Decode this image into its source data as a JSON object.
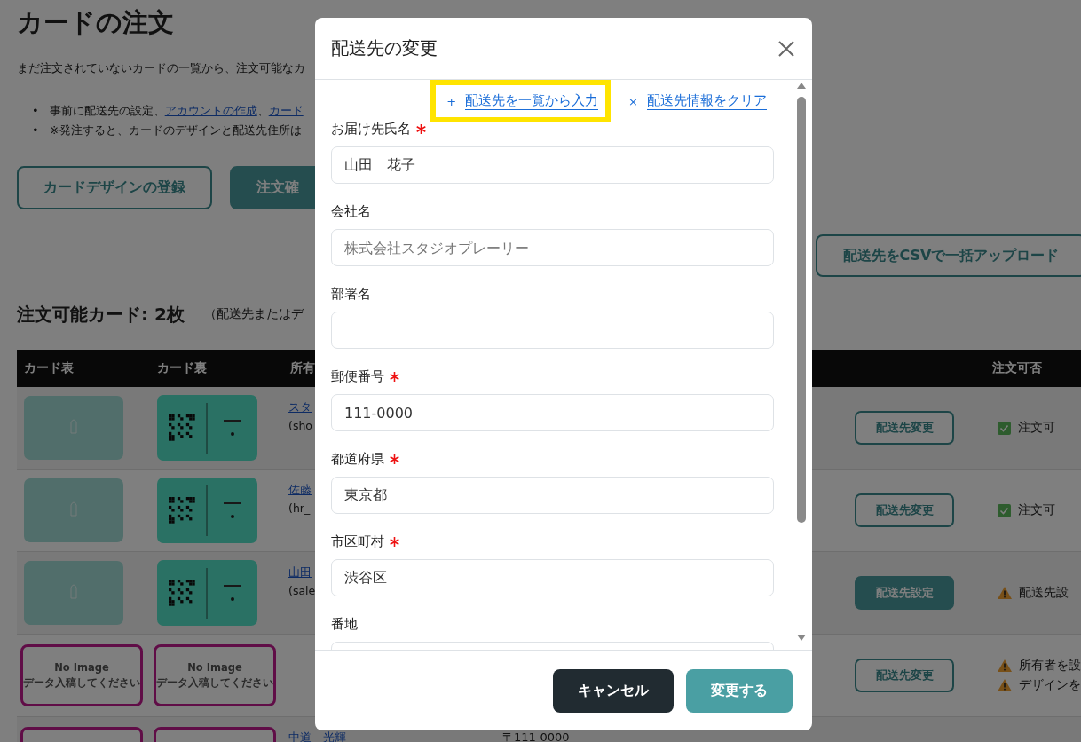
{
  "page": {
    "title": "カードの注文",
    "description": "まだ注文されていないカードの一覧から、注文可能なカ",
    "notes": [
      {
        "marker": "•",
        "parts": [
          {
            "kind": "text",
            "text": "事前に配送先の設定、"
          },
          {
            "kind": "link",
            "text": "アカウントの作成"
          },
          {
            "kind": "text",
            "text": "、"
          },
          {
            "kind": "link",
            "text": "カード"
          }
        ]
      },
      {
        "marker": "•",
        "parts": [
          {
            "kind": "text",
            "text": "※発注すると、カードのデザインと配送先住所は"
          }
        ]
      }
    ],
    "buttons": [
      {
        "label": "カードデザインの登録",
        "kind": "outline"
      },
      {
        "label": "注文確",
        "kind": "solid"
      }
    ],
    "csv_button": {
      "label": "配送先をCSVで一括アップロード"
    },
    "section": {
      "title": "注文可能カード: 2枚",
      "note": "（配送先またはデ"
    }
  },
  "table": {
    "columns": [
      "カード表",
      "カード裏",
      "所有"
    ],
    "status_column": "注文可否",
    "rows": [
      {
        "front": {
          "kind": "design"
        },
        "back": {
          "kind": "design"
        },
        "owner": {
          "name": "スタ",
          "id": "(sho"
        },
        "action": {
          "label": "配送先変更",
          "kind": "outline"
        },
        "status": [
          {
            "kind": "ok",
            "text": "注文可"
          }
        ]
      },
      {
        "front": {
          "kind": "design"
        },
        "back": {
          "kind": "design"
        },
        "owner": {
          "name": "佐藤",
          "id": "(hr_"
        },
        "action": {
          "label": "配送先変更",
          "kind": "outline"
        },
        "status": [
          {
            "kind": "ok",
            "text": "注文可"
          }
        ]
      },
      {
        "front": {
          "kind": "design"
        },
        "back": {
          "kind": "design"
        },
        "owner": {
          "name": "山田",
          "id": "(sale"
        },
        "action": {
          "label": "配送先設定",
          "kind": "solid"
        },
        "status": [
          {
            "kind": "warning",
            "text": "配送先設"
          }
        ]
      },
      {
        "front": {
          "kind": "no_image",
          "lines": [
            "No Image",
            "データ入稿してください"
          ]
        },
        "back": {
          "kind": "no_image",
          "lines": [
            "No Image",
            "データ入稿してください"
          ]
        },
        "action": {
          "label": "配送先変更",
          "kind": "outline"
        },
        "status": [
          {
            "kind": "warning",
            "text": "所有者を設"
          },
          {
            "kind": "warning",
            "text": "デザインを"
          }
        ]
      },
      {
        "front": {
          "kind": "no_image"
        },
        "back": {
          "kind": "no_image"
        },
        "owner": {
          "name": "中道　光輝"
        },
        "address": "〒111-0000"
      }
    ]
  },
  "modal": {
    "title": "配送先の変更",
    "links": [
      {
        "icon": "+",
        "label": "配送先を一覧から入力",
        "highlighted": true
      },
      {
        "icon": "×",
        "label": "配送先情報をクリア",
        "highlighted": false
      }
    ],
    "fields": [
      {
        "label": "お届け先氏名",
        "required": true,
        "value": "山田　花子"
      },
      {
        "label": "会社名",
        "required": false,
        "placeholder": "株式会社スタジオプレーリー"
      },
      {
        "label": "部署名",
        "required": false
      },
      {
        "label": "郵便番号",
        "required": true,
        "value": "111-0000"
      },
      {
        "label": "都道府県",
        "required": true,
        "value": "東京都"
      },
      {
        "label": "市区町村",
        "required": true,
        "value": "渋谷区"
      },
      {
        "label": "番地",
        "required": false
      }
    ],
    "buttons": [
      {
        "label": "キャンセル",
        "kind": "dark"
      },
      {
        "label": "変更する",
        "kind": "primary"
      }
    ]
  }
}
